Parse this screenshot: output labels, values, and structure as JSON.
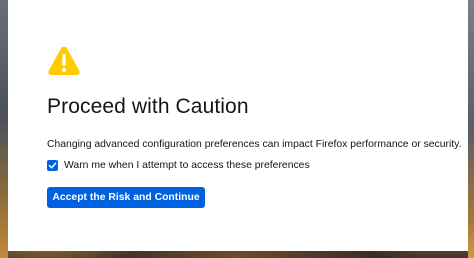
{
  "page": {
    "warning_icon": "warning-triangle-icon",
    "title": "Proceed with Caution",
    "description": "Changing advanced configuration preferences can impact Firefox performance or security.",
    "warn_checkbox": {
      "label": "Warn me when I attempt to access these preferences",
      "checked": true
    },
    "accept_button_label": "Accept the Risk and Continue"
  },
  "colors": {
    "accent": "#0061e0",
    "warning": "#ffcc00",
    "text": "#15141a",
    "background": "#ffffff"
  }
}
